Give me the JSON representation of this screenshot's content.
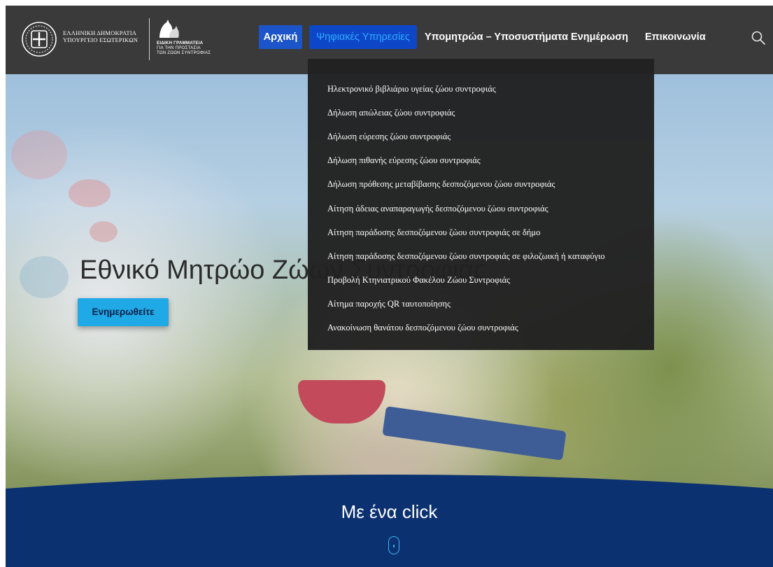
{
  "header": {
    "brand_primary_lines": [
      "ΕΛΛΗΝΙΚΗ ΔΗΜΟΚΡΑΤΙΑ",
      "ΥΠΟΥΡΓΕΙΟ ΕΣΩΤΕΡΙΚΩΝ"
    ],
    "brand_secondary_lines": [
      "ΕΙΔΙΚΗ ΓΡΑΜΜΑΤΕΙΑ",
      "ΓΙΑ ΤΗΝ ΠΡΟΣΤΑΣΙΑ",
      "ΤΩΝ ΖΩΩΝ ΣΥΝΤΡΟΦΙΑΣ"
    ],
    "nav": {
      "home": "Αρχική",
      "services": "Ψηφιακές Υπηρεσίες",
      "registries": "Υπομητρώα – Υποσυστήματα",
      "news": "Ενημέρωση",
      "contact": "Επικοινωνία"
    },
    "search_icon": "search-icon"
  },
  "dropdown": {
    "items": [
      "Ηλεκτρονικό βιβλιάριο υγείας ζώου συντροφιάς",
      "Δήλωση απώλειας ζώου συντροφιάς",
      "Δήλωση εύρεσης ζώου συντροφιάς",
      "Δήλωση πιθανής εύρεσης ζώου συντροφιάς",
      "Δήλωση πρόθεσης μεταβίβασης δεσποζόμενου ζώου συντροφιάς",
      "Αίτηση άδειας αναπαραγωγής δεσποζόμενου ζώου συντροφιάς",
      "Αίτηση παράδοσης δεσποζόμενου ζώου συντροφιάς σε δήμο",
      "Αίτηση παράδοσης δεσποζόμενου ζώου συντροφιάς σε φιλοζωική ή καταφύγιο",
      "Προβολή Κτηνιατρικού Φακέλου Ζώου Συντροφιάς",
      "Αίτημα παροχής QR ταυτοποίησης",
      "Ανακοίνωση θανάτου δεσποζόμενου ζώου συντροφιάς"
    ]
  },
  "hero": {
    "title": "Εθνικό Μητρώο Ζώων Συντροφιάς",
    "button_label": "Ενημερωθείτε"
  },
  "section": {
    "title": "Με ένα click",
    "scroll_icon": "mouse-scroll-icon"
  },
  "colors": {
    "header_bg": "#3a3a3a",
    "nav_active_bg": "#1c55c9",
    "dropdown_bg": "#212121",
    "hero_button_bg": "#1fa9e6",
    "section_bg": "#0b3170"
  }
}
